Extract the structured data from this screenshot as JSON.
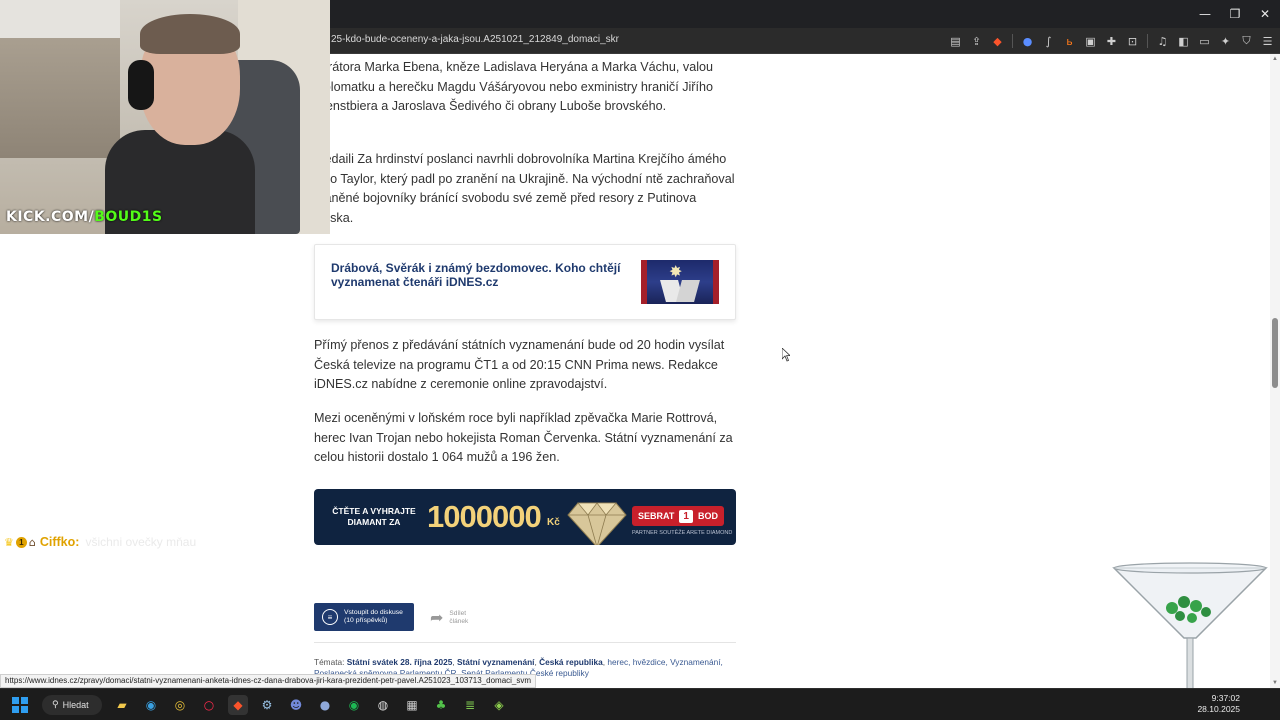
{
  "browser": {
    "url": "25-kdo-bude-oceneny-a-jaka-jsou.A251021_212849_domaci_skr",
    "window_controls": {
      "minimize": "—",
      "restore": "❐",
      "close": "✕"
    }
  },
  "article": {
    "p1": "derátora Marka Ebena, kněze Ladislava Heryána a Marka Váchu, valou diplomatku a herečku Magdu Vášáryovou nebo exministry hraničí Jiřího Dienstbiera a Jaroslava Šedivého či obrany Luboše brovského.",
    "p2": "medaili Za hrdinství poslanci navrhli dobrovolníka Martina Krejčího ámého jako Taylor, který padl po zranění na Ukrajině. Na východní ntě zachraňoval zraněné bojovníky bránící svobodu své země před resory z Putinova Ruska.",
    "related_title": "Drábová, Svěrák i známý bezdomovec. Koho chtějí vyznamenat čtenáři iDNES.cz",
    "p3": "Přímý přenos z předávání státních vyznamenání bude od 20 hodin vysílat Česká televize na programu ČT1 a od 20:15 CNN Prima news. Redakce iDNES.cz nabídne z ceremonie online zpravodajství.",
    "p4": "Mezi oceněnými v loňském roce byli například zpěvačka Marie Rottrová, herec Ivan Trojan nebo hokejista Roman Červenka. Státní vyznamenání za celou historii dostalo 1 064 mužů a 196 žen."
  },
  "banner": {
    "text": "ČTĚTE A VYHRAJTE DIAMANT ZA",
    "amount": "1000000",
    "currency": "Kč",
    "cta": "SEBRAT",
    "cta_num": "1",
    "cta_suffix": "BOD",
    "partner": "PARTNER SOUTĚŽE  ARETE DIAMOND"
  },
  "discussion": {
    "label_line1": "Vstoupit do diskuse",
    "label_line2": "(10 příspěvků)"
  },
  "share": {
    "line1": "Sdílet",
    "line2": "článek"
  },
  "tags": {
    "label": "Témata:",
    "strong1": "Státní svátek 28. října 2025",
    "strong2": "Státní vyznamenání",
    "strong3": "Česká republika",
    "rest": "herec, hvězdice, Vyznamenání,",
    "line2": "Poslanecká sněmovna Parlamentu ČR, Senát Parlamentu České republiky"
  },
  "webcam": {
    "logo_a": "KICK.COM/",
    "logo_b": "BOUD1S"
  },
  "chat": {
    "badge_num": "1",
    "user": "Ciffko:",
    "message": "všichni ovečky mňau"
  },
  "status_url": "https://www.idnes.cz/zpravy/domaci/statni-vyznamenani-anketa-idnes-cz-dana-drabova-jiri-kara-prezident-petr-pavel.A251023_103713_domaci_svm",
  "taskbar": {
    "search": "Hledat",
    "time": "9:37:02",
    "date": "28.10.2025"
  },
  "colors": {
    "accent": "#1f3a6e",
    "kick": "#53fc18",
    "banner_bg": "#0f2340",
    "cta_red": "#c8202b"
  }
}
